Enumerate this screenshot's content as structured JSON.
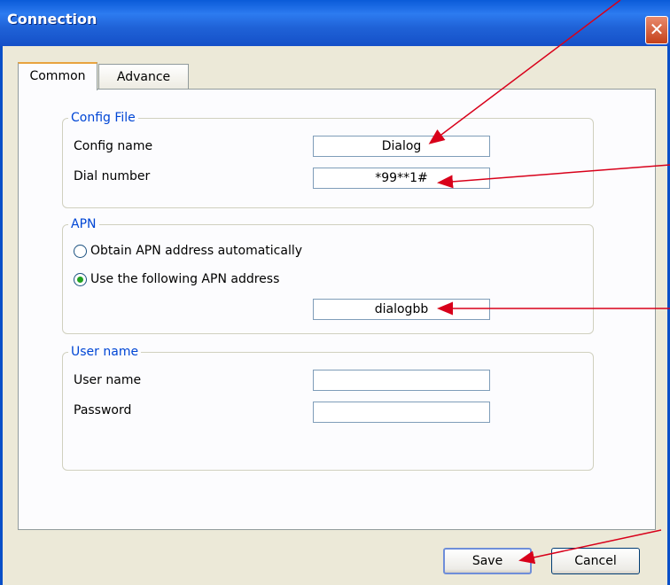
{
  "window": {
    "title": "Connection",
    "close_icon": "close-icon"
  },
  "tabs": [
    {
      "label": "Common",
      "active": true
    },
    {
      "label": "Advance",
      "active": false
    }
  ],
  "config_file": {
    "legend": "Config File",
    "config_name_label": "Config name",
    "config_name_value": "Dialog",
    "dial_number_label": "Dial number",
    "dial_number_value": "*99**1#"
  },
  "apn": {
    "legend": "APN",
    "auto_label": "Obtain APN address automatically",
    "manual_label": "Use the following APN address",
    "selected": "manual",
    "address_value": "dialogbb"
  },
  "user": {
    "legend": "User name",
    "username_label": "User name",
    "username_value": "",
    "password_label": "Password",
    "password_value": ""
  },
  "buttons": {
    "save": "Save",
    "cancel": "Cancel"
  },
  "colors": {
    "title_bar": "#1f62d7",
    "legend": "#0046d5",
    "annotation_arrow": "#d8001a"
  }
}
